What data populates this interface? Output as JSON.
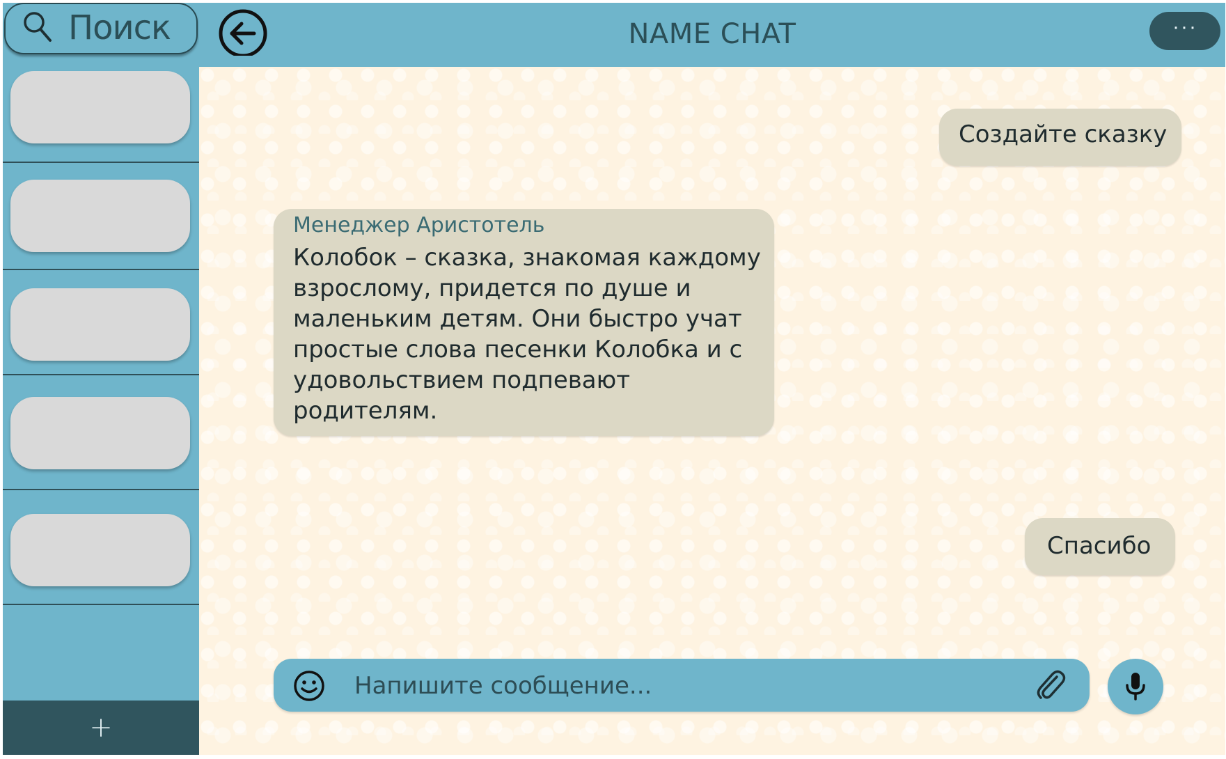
{
  "colors": {
    "sidebar_bg": "#6fb5cb",
    "header_bg": "#6fb5cb",
    "dark_accent": "#30555e",
    "chat_bg": "#fef3e1",
    "bubble_bg": "#dcd8c5",
    "chat_placeholder_pill": "#d9d9d9"
  },
  "sidebar": {
    "search": {
      "label": "Поиск",
      "icon": "search-icon"
    },
    "chats": [
      {},
      {},
      {},
      {},
      {}
    ],
    "add_button": {
      "label": "+"
    }
  },
  "header": {
    "back_icon": "arrow-left-circle-icon",
    "title": "NAME CHAT",
    "menu_label": "···"
  },
  "messages": [
    {
      "direction": "outgoing",
      "text": "Создайте сказку"
    },
    {
      "direction": "incoming",
      "sender": "Менеджер Аристотель",
      "text": "Колобок – сказка, знакомая каждому\nвзрослому, придется по душе и\nмаленьким детям. Они быстро учат\nпростые слова песенки Колобка и с\nудовольствием подпевают\nродителям."
    },
    {
      "direction": "outgoing",
      "text": "Спасибо"
    }
  ],
  "composer": {
    "placeholder": "Напишите сообщение...",
    "value": "",
    "emoji_icon": "emoji-smile-icon",
    "attach_icon": "paperclip-icon",
    "mic_icon": "microphone-icon"
  }
}
